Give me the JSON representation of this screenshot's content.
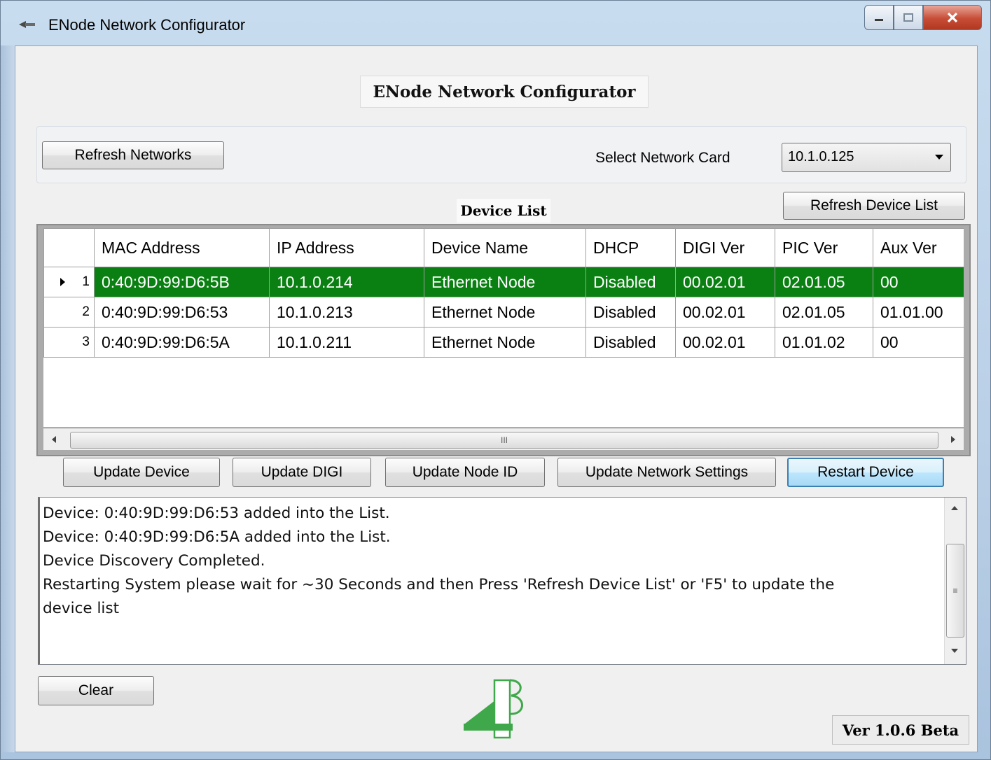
{
  "window": {
    "title": "ENode Network Configurator",
    "controls": {
      "minimize": "minimize-icon",
      "maximize": "maximize-icon",
      "close": "close-icon"
    }
  },
  "header": {
    "title": "ENode Network Configurator"
  },
  "network": {
    "refresh_label": "Refresh Networks",
    "select_label": "Select Network Card",
    "selected_card": "10.1.0.125"
  },
  "device_list": {
    "title": "Device List",
    "refresh_label": "Refresh Device List",
    "columns": [
      "MAC Address",
      "IP Address",
      "Device Name",
      "DHCP",
      "DIGI Ver",
      "PIC Ver",
      "Aux Ver"
    ],
    "rows": [
      {
        "num": "1",
        "cells": [
          "0:40:9D:99:D6:5B",
          "10.1.0.214",
          "Ethernet Node",
          "Disabled",
          "00.02.01",
          "02.01.05",
          "00"
        ]
      },
      {
        "num": "2",
        "cells": [
          "0:40:9D:99:D6:53",
          "10.1.0.213",
          "Ethernet Node",
          "Disabled",
          "00.02.01",
          "02.01.05",
          "01.01.00"
        ]
      },
      {
        "num": "3",
        "cells": [
          "0:40:9D:99:D6:5A",
          "10.1.0.211",
          "Ethernet Node",
          "Disabled",
          "00.02.01",
          "01.01.02",
          "00"
        ]
      }
    ],
    "scroll_grip": "III"
  },
  "actions": {
    "update_device": "Update Device",
    "update_digi": "Update DIGI",
    "update_node_id": "Update Node ID",
    "update_network": "Update Network Settings",
    "restart_device": "Restart Device"
  },
  "log": {
    "lines": [
      "Device: 0:40:9D:99:D6:53 added into the List.",
      "Device: 0:40:9D:99:D6:5A added into the List.",
      "Device Discovery Completed.",
      "Restarting System please wait for ~30 Seconds and then Press 'Refresh Device List' or 'F5' to update the",
      "device list"
    ],
    "scroll_grip": "≡"
  },
  "footer": {
    "clear_label": "Clear",
    "version": "Ver 1.0.6 Beta"
  },
  "colors": {
    "selected_row": "#0b8012",
    "logo": "#3fa84a"
  }
}
